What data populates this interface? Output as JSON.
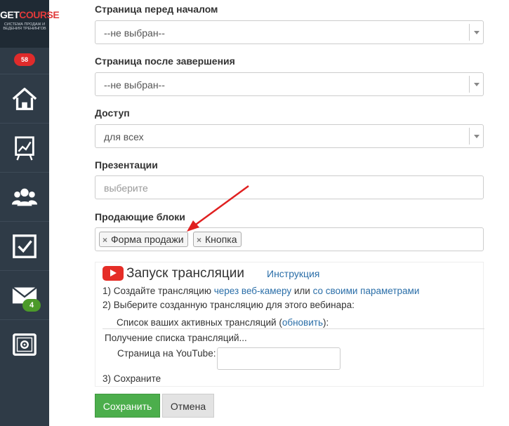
{
  "sidebar": {
    "logo": {
      "brand_get": "GET",
      "brand_course": "COURSE",
      "tagline": "СИСТЕМА ПРОДАЖ И ВЕДЕНИЯ ТРЕНИНГОВ"
    },
    "notifications_badge": "58",
    "items": [
      {
        "icon": "home-icon"
      },
      {
        "icon": "chart-board-icon"
      },
      {
        "icon": "users-icon"
      },
      {
        "icon": "checkbox-icon"
      },
      {
        "icon": "mail-icon",
        "badge": "4"
      },
      {
        "icon": "safe-icon"
      }
    ]
  },
  "form": {
    "page_before": {
      "label": "Страница перед началом",
      "value": "--не выбран--"
    },
    "page_after": {
      "label": "Страница после завершения",
      "value": "--не выбран--"
    },
    "access": {
      "label": "Доступ",
      "value": "для всех"
    },
    "presentations": {
      "label": "Презентации",
      "placeholder": "выберите"
    },
    "selling_blocks": {
      "label": "Продающие блоки",
      "tags": [
        "Форма продажи",
        "Кнопка"
      ],
      "remove_glyph": "×"
    }
  },
  "broadcast": {
    "title": "Запуск трансляции",
    "instruction_link": "Инструкция",
    "step1_prefix": "1) Создайте трансляцию ",
    "step1_link1": "через веб-камеру",
    "step1_mid": " или ",
    "step1_link2": "со своими параметрами",
    "step2": "2) Выберите созданную трансляцию для этого вебинара:",
    "active_prefix": "Список ваших активных трансляций (",
    "active_link": "обновить",
    "active_suffix": "):",
    "loading": "Получение списка трансляций...",
    "youtube_page_label": "Страница на YouTube:",
    "step3": "3) Сохраните"
  },
  "buttons": {
    "save": "Сохранить",
    "cancel": "Отмена"
  },
  "colors": {
    "sidebar": "#2f3b47",
    "save": "#4cae4c",
    "link": "#2a6ea8",
    "badge_red": "#e02b2b",
    "badge_green": "#4c9a2a",
    "arrow": "#e02020"
  }
}
